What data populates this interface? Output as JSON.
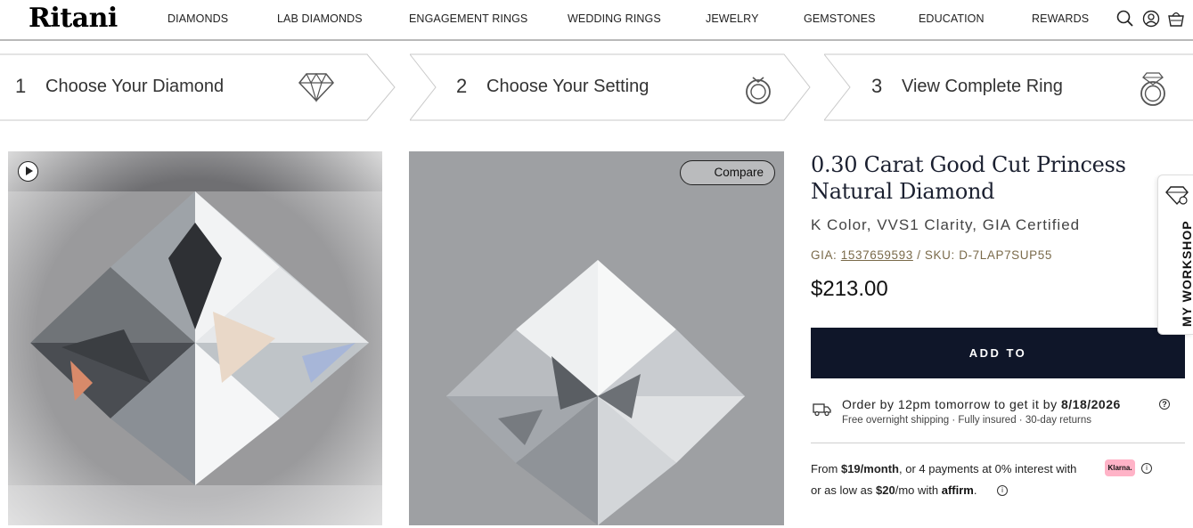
{
  "brand": {
    "logo_text": "Ritani"
  },
  "nav": {
    "items": [
      "DIAMONDS",
      "LAB DIAMONDS",
      "ENGAGEMENT RINGS",
      "WEDDING RINGS",
      "JEWELRY",
      "GEMSTONES",
      "EDUCATION",
      "REWARDS"
    ],
    "icons": [
      "search-icon",
      "account-icon",
      "cart-icon"
    ]
  },
  "steps": [
    {
      "number": "1",
      "label": "Choose Your Diamond",
      "icon": "diamond-icon"
    },
    {
      "number": "2",
      "label": "Choose Your Setting",
      "icon": "ring-setting-icon"
    },
    {
      "number": "3",
      "label": "View Complete Ring",
      "icon": "complete-ring-icon"
    }
  ],
  "gallery": {
    "compare_label": "Compare",
    "play_icon": "play-icon"
  },
  "product": {
    "title": "0.30 Carat Good Cut Princess Natural Diamond",
    "subtitle": "K Color, VVS1 Clarity, GIA Certified",
    "gia_label": "GIA:",
    "gia_number": "1537659593",
    "sku_text": "/ SKU: D-7LAP7SUP55",
    "price": "$213.00",
    "add_to_label": "ADD TO"
  },
  "shipping": {
    "order_prefix": "Order by 12pm tomorrow to get it by",
    "order_date": "8/18/2026",
    "sub": "Free overnight shipping · Fully insured · 30-day returns"
  },
  "financing": {
    "klarna_from": "From",
    "klarna_amount": "$19/month",
    "klarna_rest": ", or 4 payments at 0% interest with",
    "klarna_badge": "Klarna.",
    "affirm_prefix": "or as low as",
    "affirm_amount": "$20",
    "affirm_mid": "/mo with",
    "affirm_logo": "affirm",
    "affirm_dot": "."
  },
  "workshop": {
    "label": "MY WORKSHOP"
  },
  "colors": {
    "primary_button": "#0f1629",
    "accent_gold": "#7a6a4a",
    "klarna_pink": "#ffb3c7"
  }
}
